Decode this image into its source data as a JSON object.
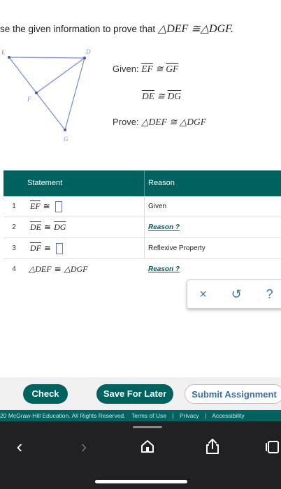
{
  "instruction": {
    "text": "se the given information to prove that",
    "statement": "△DEF ≅△DGF."
  },
  "figure": {
    "labels": {
      "E": "E",
      "D": "D",
      "F": "F",
      "G": "G"
    }
  },
  "given": {
    "label": "Given:",
    "line1_a": "EF",
    "line1_rel": "≅",
    "line1_b": "GF",
    "line2_a": "DE",
    "line2_rel": "≅",
    "line2_b": "DG",
    "prove_label": "Prove:",
    "prove": "△DEF ≅ △DGF"
  },
  "table": {
    "headers": {
      "statement": "Statement",
      "reason": "Reason"
    },
    "rows": [
      {
        "num": "1",
        "a": "EF",
        "rel": "≅",
        "b": "",
        "reason": "Given"
      },
      {
        "num": "2",
        "a": "DE",
        "rel": "≅",
        "b": "DG",
        "reason": "Reason ?"
      },
      {
        "num": "3",
        "a": "DF",
        "rel": "≅",
        "b": "",
        "reason": "Reflexive Property"
      },
      {
        "num": "4",
        "a": "△DEF",
        "rel": "≅",
        "b": "△DGF",
        "reason": "Reason ?"
      }
    ]
  },
  "actions": {
    "clear": "×",
    "undo": "↺",
    "help": "?"
  },
  "buttons": {
    "check": "Check",
    "save": "Save For Later",
    "submit": "Submit Assignment"
  },
  "footer": {
    "copyright": "20 McGraw-Hill Education. All Rights Reserved.",
    "terms": "Terms of Use",
    "sep": "|",
    "privacy": "Privacy",
    "accessibility": "Accessibility"
  },
  "browser": {
    "back": "‹",
    "forward": "›"
  },
  "colors": {
    "accent": "#00625f",
    "link": "#3a6ea0",
    "figure_line": "#7b8fd6",
    "figure_point": "#4a55b8"
  }
}
